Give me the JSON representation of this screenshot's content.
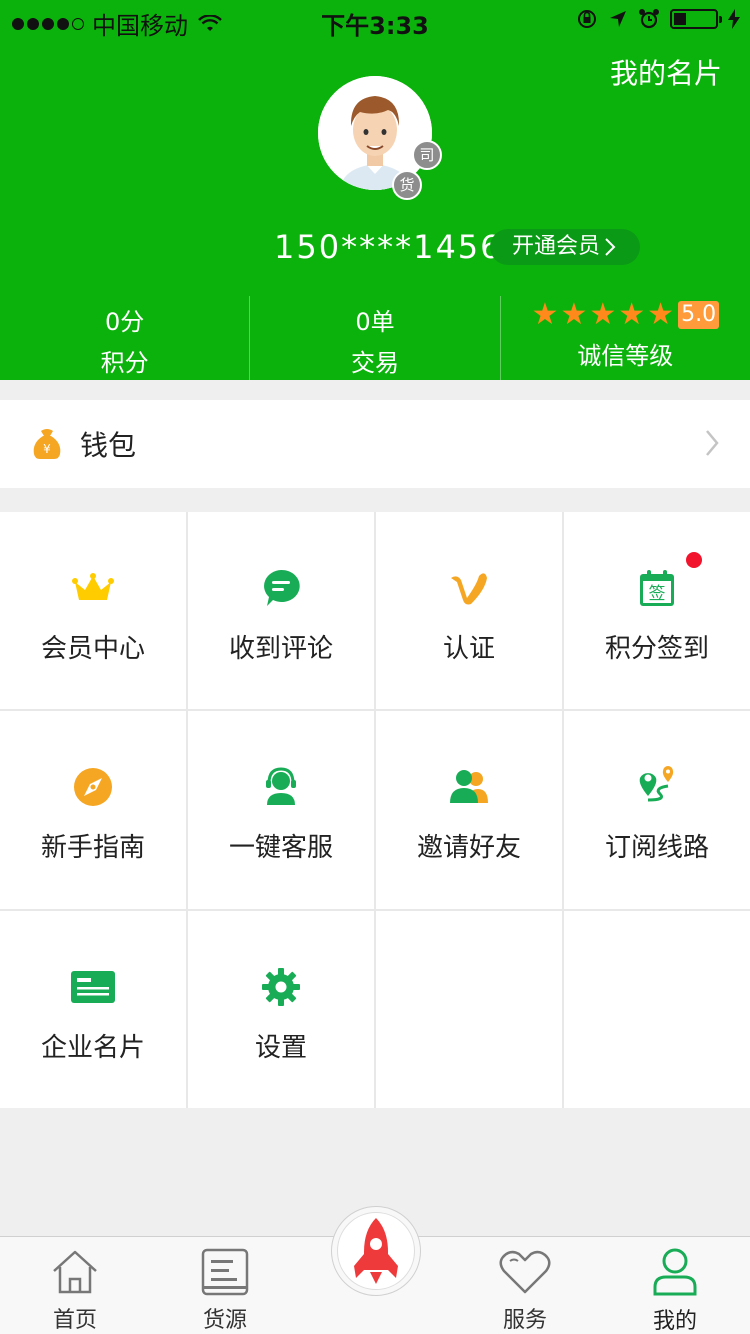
{
  "status_bar": {
    "carrier": "中国移动",
    "time": "下午3:33",
    "battery_level": 0.3
  },
  "header": {
    "my_card_label": "我的名片",
    "driver_badge": "司",
    "cargo_badge": "货",
    "phone": "150****1456",
    "vip_button": "开通会员",
    "accent_color": "#0bb20c"
  },
  "stats": [
    {
      "value": "0分",
      "label": "积分"
    },
    {
      "value": "0单",
      "label": "交易"
    },
    {
      "rating": "5.0",
      "stars": 5,
      "label": "诚信等级"
    }
  ],
  "wallet": {
    "label": "钱包",
    "icon": "money-bag-icon"
  },
  "grid": [
    {
      "label": "会员中心",
      "icon": "crown-icon",
      "color": "#ffcc00"
    },
    {
      "label": "收到评论",
      "icon": "comment-icon",
      "color": "#19ac56"
    },
    {
      "label": "认证",
      "icon": "verify-v-icon",
      "color": "#f5a623"
    },
    {
      "label": "积分签到",
      "icon": "calendar-sign-icon",
      "color": "#19ac56",
      "has_dot": true
    },
    {
      "label": "新手指南",
      "icon": "compass-icon",
      "color": "#f5a623"
    },
    {
      "label": "一键客服",
      "icon": "headset-icon",
      "color": "#19ac56"
    },
    {
      "label": "邀请好友",
      "icon": "invite-friends-icon",
      "color": "#19ac56"
    },
    {
      "label": "订阅线路",
      "icon": "route-icon",
      "color": "#19ac56"
    },
    {
      "label": "企业名片",
      "icon": "business-card-icon",
      "color": "#19ac56"
    },
    {
      "label": "设置",
      "icon": "gear-icon",
      "color": "#19ac56"
    }
  ],
  "calendar_char": "签",
  "tabbar": [
    {
      "label": "首页",
      "icon": "home-icon"
    },
    {
      "label": "货源",
      "icon": "document-icon"
    },
    {
      "label": "",
      "icon": "rocket-icon"
    },
    {
      "label": "服务",
      "icon": "heart-icon"
    },
    {
      "label": "我的",
      "icon": "person-icon",
      "active": true
    }
  ]
}
